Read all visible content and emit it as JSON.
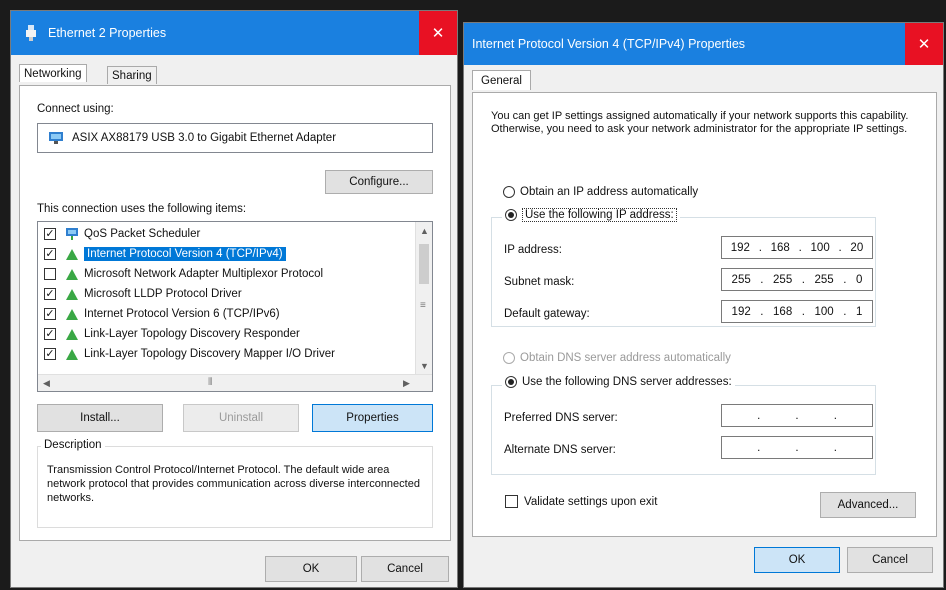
{
  "eth_dialog": {
    "title": "Ethernet 2 Properties",
    "tabs": [
      {
        "label": "Networking"
      },
      {
        "label": "Sharing"
      }
    ],
    "connect_using_label": "Connect using:",
    "adapter_name": "ASIX AX88179 USB 3.0 to Gigabit Ethernet Adapter",
    "configure_label": "Configure...",
    "items_label": "This connection uses the following items:",
    "items": [
      {
        "label": "QoS Packet Scheduler",
        "checked": true
      },
      {
        "label": "Internet Protocol Version 4 (TCP/IPv4)",
        "checked": true,
        "selected": true
      },
      {
        "label": "Microsoft Network Adapter Multiplexor Protocol",
        "checked": false
      },
      {
        "label": "Microsoft LLDP Protocol Driver",
        "checked": true
      },
      {
        "label": "Internet Protocol Version 6 (TCP/IPv6)",
        "checked": true
      },
      {
        "label": "Link-Layer Topology Discovery Responder",
        "checked": true
      },
      {
        "label": "Link-Layer Topology Discovery Mapper I/O Driver",
        "checked": true
      }
    ],
    "install_label": "Install...",
    "uninstall_label": "Uninstall",
    "properties_label": "Properties",
    "description_label": "Description",
    "description_text": "Transmission Control Protocol/Internet Protocol. The default wide area network protocol that provides communication across diverse interconnected networks.",
    "ok_label": "OK",
    "cancel_label": "Cancel"
  },
  "ipv4_dialog": {
    "title": "Internet Protocol Version 4 (TCP/IPv4) Properties",
    "tab_label": "General",
    "intro_text": "You can get IP settings assigned automatically if your network supports this capability. Otherwise, you need to ask your network administrator for the appropriate IP settings.",
    "obtain_ip_auto_label": "Obtain an IP address automatically",
    "use_ip_label": "Use the following IP address:",
    "ip_address_label": "IP address:",
    "ip_address": [
      "192",
      "168",
      "100",
      "20"
    ],
    "subnet_mask_label": "Subnet mask:",
    "subnet_mask": [
      "255",
      "255",
      "255",
      "0"
    ],
    "gateway_label": "Default gateway:",
    "gateway": [
      "192",
      "168",
      "100",
      "1"
    ],
    "obtain_dns_auto_label": "Obtain DNS server address automatically",
    "use_dns_label": "Use the following DNS server addresses:",
    "preferred_dns_label": "Preferred DNS server:",
    "alternate_dns_label": "Alternate DNS server:",
    "validate_label": "Validate settings upon exit",
    "advanced_label": "Advanced...",
    "ok_label": "OK",
    "cancel_label": "Cancel"
  },
  "colors": {
    "titlebar": "#1a80e0",
    "close": "#e81123",
    "selection": "#0078d7"
  }
}
